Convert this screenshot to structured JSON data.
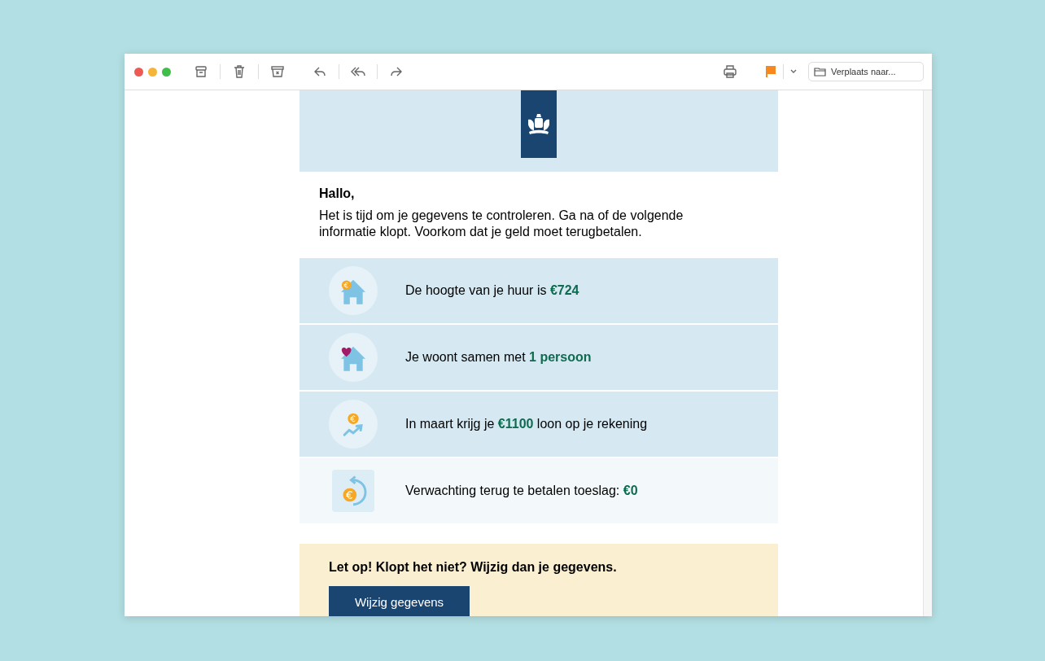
{
  "toolbar": {
    "flagged": true,
    "move_field": {
      "placeholder": "Verplaats naar..."
    }
  },
  "email": {
    "greeting": "Hallo,",
    "intro": "Het is tijd om je gegevens te controleren. Ga na of de volgende informatie klopt. Voorkom dat je geld moet terugbetalen.",
    "rows": [
      {
        "kind": "rent",
        "text": "De hoogte van je huur is **€724**"
      },
      {
        "kind": "household",
        "text": "Je woont samen met **1 persoon**"
      },
      {
        "kind": "income",
        "text": "In maart krijg je **€1100** loon op je rekening"
      },
      {
        "kind": "repayment",
        "text": "Verwachting terug te betalen toeslag: **€0**"
      }
    ],
    "notice": {
      "text": "Let op! Klopt het niet? Wijzig dan je gegevens.",
      "button": "Wijzig gegevens"
    }
  }
}
